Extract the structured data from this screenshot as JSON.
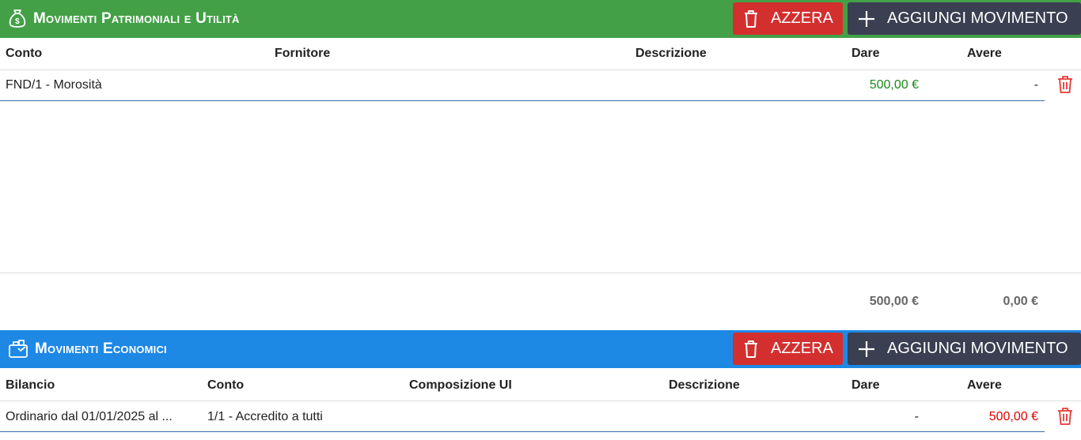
{
  "patrimoniali": {
    "title": "Movimenti Patrimoniali e Utilità",
    "reset_label": "AZZERA",
    "add_label": "AGGIUNGI MOVIMENTO",
    "columns": {
      "conto": "Conto",
      "fornitore": "Fornitore",
      "descrizione": "Descrizione",
      "dare": "Dare",
      "avere": "Avere"
    },
    "rows": [
      {
        "conto": "FND/1 - Morosità",
        "fornitore": "",
        "descrizione": "",
        "dare": "500,00 €",
        "avere": "-"
      }
    ],
    "totals": {
      "dare": "500,00 €",
      "avere": "0,00 €"
    }
  },
  "economici": {
    "title": "Movimenti Economici",
    "reset_label": "AZZERA",
    "add_label": "AGGIUNGI MOVIMENTO",
    "columns": {
      "bilancio": "Bilancio",
      "conto": "Conto",
      "composizione": "Composizione UI",
      "descrizione": "Descrizione",
      "dare": "Dare",
      "avere": "Avere"
    },
    "rows": [
      {
        "bilancio": "Ordinario dal 01/01/2025 al ...",
        "conto": "1/1 - Accredito a tutti",
        "composizione": "",
        "descrizione": "",
        "dare": "-",
        "avere": "500,00 €"
      }
    ]
  },
  "colors": {
    "green_header": "#43a047",
    "blue_header": "#1e88e5",
    "danger": "#d32f2f",
    "dark_button": "#3a3f51",
    "positive_amount": "#1b8a1b",
    "negative_amount": "#e00000"
  }
}
